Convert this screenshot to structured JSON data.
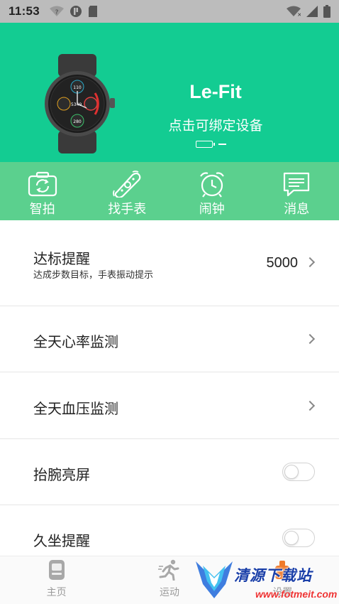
{
  "status_bar": {
    "time": "11:53",
    "icons": [
      "wifi-question-icon",
      "app-notification-icon",
      "sd-card-icon",
      "wifi-off-icon",
      "signal-icon",
      "battery-icon"
    ]
  },
  "header": {
    "app_title": "Le-Fit",
    "bind_hint": "点击可绑定设备",
    "device_image": "smartwatch-image",
    "colors": {
      "primary": "#13cc92",
      "secondary": "#5bd08e"
    }
  },
  "quick_actions": [
    {
      "label": "智拍",
      "icon": "camera-icon"
    },
    {
      "label": "找手表",
      "icon": "find-watch-icon"
    },
    {
      "label": "闹钟",
      "icon": "alarm-clock-icon"
    },
    {
      "label": "消息",
      "icon": "message-icon"
    }
  ],
  "settings": {
    "goal_reminder": {
      "title": "达标提醒",
      "subtitle": "达成步数目标，手表振动提示",
      "value": "5000"
    },
    "heart_rate": {
      "title": "全天心率监测"
    },
    "blood_pressure": {
      "title": "全天血压监测"
    },
    "raise_to_wake": {
      "title": "抬腕亮屏",
      "enabled": false
    },
    "sedentary": {
      "title": "久坐提醒",
      "enabled": false
    }
  },
  "bottom_nav": [
    {
      "label": "主页",
      "icon": "home-icon"
    },
    {
      "label": "运动",
      "icon": "running-icon"
    },
    {
      "label": "设置",
      "icon": "settings-icon"
    }
  ],
  "watermark": {
    "text": "清源下载站",
    "url": "www.fotmeit.com"
  }
}
